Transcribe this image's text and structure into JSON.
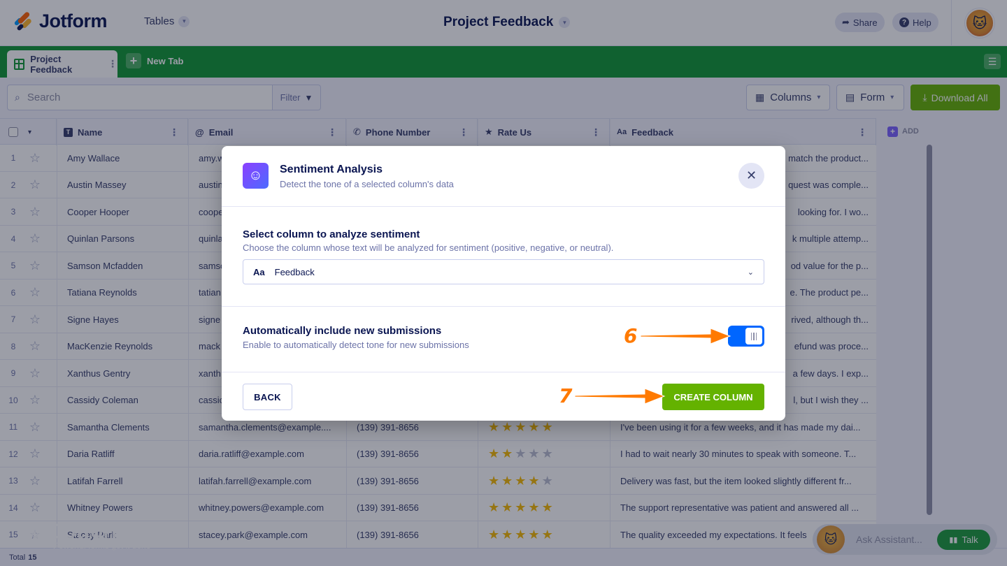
{
  "app": {
    "brand": "Jotform",
    "section": "Tables",
    "project_title": "Project Feedback",
    "share_label": "Share",
    "help_label": "Help"
  },
  "tabs": {
    "active": "Project Feedback",
    "new_tab": "New Tab"
  },
  "toolbar": {
    "search_placeholder": "Search",
    "filter_label": "Filter",
    "columns_label": "Columns",
    "form_label": "Form",
    "download_label": "Download All"
  },
  "table": {
    "columns": [
      "Name",
      "Email",
      "Phone Number",
      "Rate Us",
      "Feedback"
    ],
    "add_label": "ADD",
    "rows": [
      {
        "n": "1",
        "name": "Amy Wallace",
        "email": "amy.w",
        "phone": "",
        "rating": 0,
        "feedback": "match the product..."
      },
      {
        "n": "2",
        "name": "Austin Massey",
        "email": "austin",
        "phone": "",
        "rating": 0,
        "feedback": "quest was comple..."
      },
      {
        "n": "3",
        "name": "Cooper Hooper",
        "email": "coope",
        "phone": "",
        "rating": 0,
        "feedback": "looking for. I wo..."
      },
      {
        "n": "4",
        "name": "Quinlan Parsons",
        "email": "quinla",
        "phone": "",
        "rating": 0,
        "feedback": "k multiple attemp..."
      },
      {
        "n": "5",
        "name": "Samson Mcfadden",
        "email": "samso",
        "phone": "",
        "rating": 0,
        "feedback": "od value for the p..."
      },
      {
        "n": "6",
        "name": "Tatiana Reynolds",
        "email": "tatian",
        "phone": "",
        "rating": 0,
        "feedback": "e. The product pe..."
      },
      {
        "n": "7",
        "name": "Signe Hayes",
        "email": "signe",
        "phone": "",
        "rating": 0,
        "feedback": "rived, although th..."
      },
      {
        "n": "8",
        "name": "MacKenzie Reynolds",
        "email": "mack",
        "phone": "",
        "rating": 0,
        "feedback": "efund was proce..."
      },
      {
        "n": "9",
        "name": "Xanthus Gentry",
        "email": "xanth",
        "phone": "",
        "rating": 0,
        "feedback": "a few days. I exp..."
      },
      {
        "n": "10",
        "name": "Cassidy Coleman",
        "email": "cassic",
        "phone": "",
        "rating": 0,
        "feedback": "l, but I wish they ..."
      },
      {
        "n": "11",
        "name": "Samantha Clements",
        "email": "samantha.clements@example....",
        "phone": "(139) 391-8656",
        "rating": 5,
        "feedback": "I've been using it for a few weeks, and it has made my dai..."
      },
      {
        "n": "12",
        "name": "Daria Ratliff",
        "email": "daria.ratliff@example.com",
        "phone": "(139) 391-8656",
        "rating": 2,
        "feedback": "I had to wait nearly 30 minutes to speak with someone. T..."
      },
      {
        "n": "13",
        "name": "Latifah Farrell",
        "email": "latifah.farrell@example.com",
        "phone": "(139) 391-8656",
        "rating": 4,
        "feedback": "Delivery was fast, but the item looked slightly different fr..."
      },
      {
        "n": "14",
        "name": "Whitney Powers",
        "email": "whitney.powers@example.com",
        "phone": "(139) 391-8656",
        "rating": 5,
        "feedback": "The support representative was patient and answered all ..."
      },
      {
        "n": "15",
        "name": "Stacey Park",
        "email": "stacey.park@example.com",
        "phone": "(139) 391-8656",
        "rating": 5,
        "feedback": "The quality exceeded my expectations. It feels"
      }
    ],
    "footer_label": "Total",
    "footer_count": "15"
  },
  "watermark": {
    "brand": "Jotform",
    "tagline": "Powerful forms get it done"
  },
  "modal": {
    "title": "Sentiment Analysis",
    "subtitle": "Detect the tone of a selected column's data",
    "select_title": "Select column to analyze sentiment",
    "select_desc": "Choose the column whose text will be analyzed for sentiment (positive, negative, or neutral).",
    "select_type": "Aa",
    "select_value": "Feedback",
    "auto_title": "Automatically include new submissions",
    "auto_desc": "Enable to automatically detect tone for new submissions",
    "auto_enabled": true,
    "back_label": "BACK",
    "create_label": "CREATE COLUMN"
  },
  "annotations": {
    "step6": "6",
    "step7": "7",
    "color": "#ff7a00"
  },
  "assistant": {
    "placeholder": "Ask Assistant...",
    "talk_label": "Talk"
  },
  "colors": {
    "brand_green": "#0f9632",
    "action_green": "#64b200",
    "toggle_blue": "#0066ff",
    "navy": "#0a1551"
  }
}
